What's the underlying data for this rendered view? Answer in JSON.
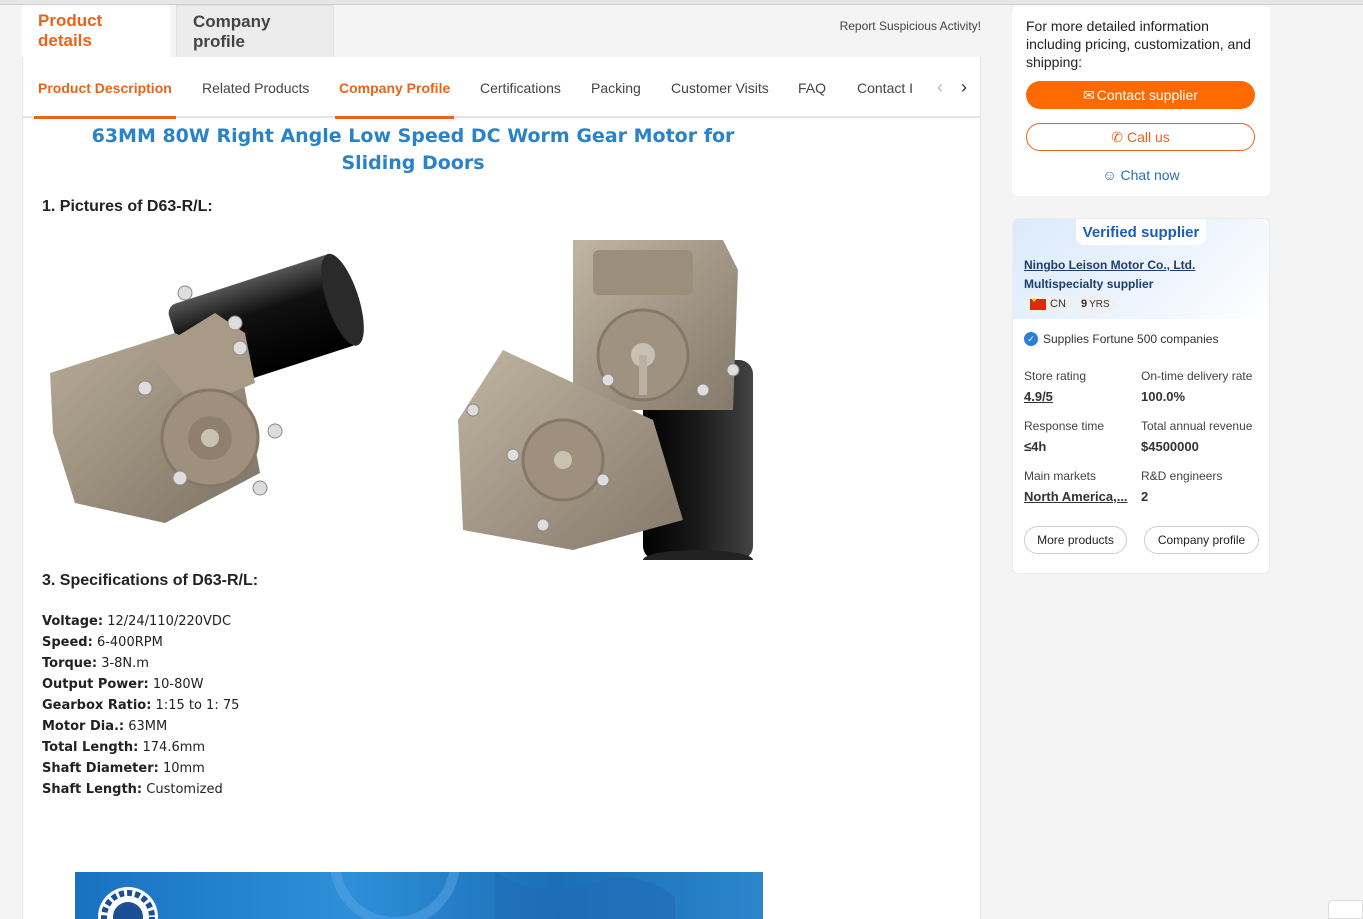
{
  "top_tabs": {
    "product_details": "Product details",
    "company_profile": "Company profile"
  },
  "report": "Report Suspicious Activity!",
  "sub_tabs": [
    "Product Description",
    "Related Products",
    "Company Profile",
    "Certifications",
    "Packing",
    "Customer Visits",
    "FAQ",
    "Contact I"
  ],
  "content": {
    "title": "63MM 80W Right Angle Low Speed DC Worm Gear Motor for Sliding Doors",
    "section1": "1. Pictures of D63-R/L:",
    "section3": "3. Specifications of D63-R/L:",
    "specs": [
      {
        "k": "Voltage:",
        "v": "12/24/110/220VDC"
      },
      {
        "k": "Speed:",
        "v": "6-400RPM"
      },
      {
        "k": "Torque:",
        "v": "3-8N.m"
      },
      {
        "k": "Output Power:",
        "v": "10-80W"
      },
      {
        "k": "Gearbox Ratio:",
        "v": "1:15 to 1: 75"
      },
      {
        "k": "Motor Dia.:",
        "v": "63MM"
      },
      {
        "k": "Total Length:",
        "v": "174.6mm"
      },
      {
        "k": "Shaft Diameter:",
        "v": "10mm"
      },
      {
        "k": "Shaft Length:",
        "v": "Customized"
      }
    ]
  },
  "sidebar": {
    "info": "For more detailed information including pricing, customization, and shipping:",
    "contact": "Contact supplier",
    "call": "Call us",
    "chat": "Chat now",
    "verified": "Verified supplier",
    "company": "Ningbo Leison Motor Co., Ltd.",
    "type": "Multispecialty supplier",
    "country": "CN",
    "years_num": "9",
    "years_unit": "YRS",
    "fortune": "Supplies Fortune 500 companies",
    "stats": {
      "store_rating_label": "Store rating",
      "store_rating": "4.9/5",
      "delivery_label": "On-time delivery rate",
      "delivery": "100.0%",
      "response_label": "Response time",
      "response": "≤4h",
      "revenue_label": "Total annual revenue",
      "revenue": "$4500000",
      "markets_label": "Main markets",
      "markets": "North America,...",
      "rd_label": "R&D engineers",
      "rd": "2"
    },
    "more_products": "More products",
    "company_profile": "Company profile"
  },
  "colors": {
    "accent": "#e8641a",
    "contact_button": "#ff6a00",
    "title_blue": "#2a82c8",
    "verified_blue": "#1d5fb0"
  }
}
